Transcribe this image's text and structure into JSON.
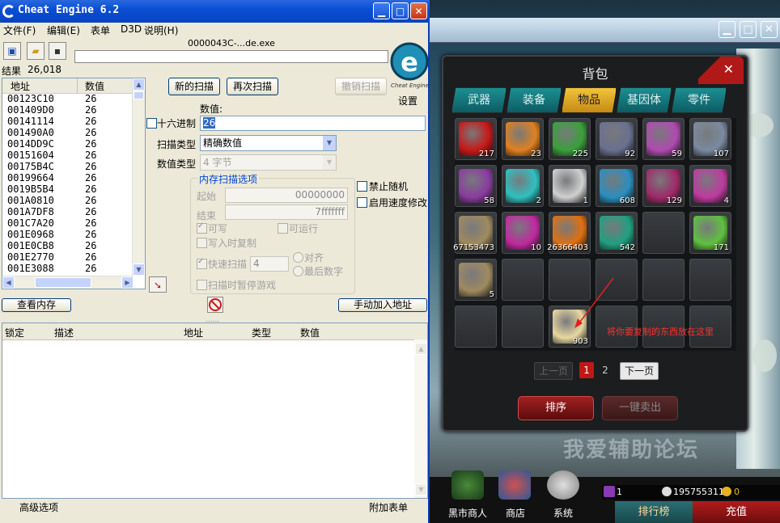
{
  "ce": {
    "title": "Cheat Engine 6.2",
    "menu": [
      "文件(F)",
      "编辑(E)",
      "表单",
      "D3D",
      "说明(H)"
    ],
    "process": "0000043C-...de.exe",
    "results_label": "结果",
    "results_count": "26,018",
    "settings": "设置",
    "logo_text": "Cheat Engine",
    "list_headers": {
      "address": "地址",
      "value": "数值"
    },
    "addresses": [
      {
        "a": "00123C10",
        "v": "26"
      },
      {
        "a": "001409D0",
        "v": "26"
      },
      {
        "a": "00141114",
        "v": "26"
      },
      {
        "a": "001490A0",
        "v": "26"
      },
      {
        "a": "0014DD9C",
        "v": "26"
      },
      {
        "a": "00151604",
        "v": "26"
      },
      {
        "a": "00175B4C",
        "v": "26"
      },
      {
        "a": "00199664",
        "v": "26"
      },
      {
        "a": "0019B5B4",
        "v": "26"
      },
      {
        "a": "001A0810",
        "v": "26"
      },
      {
        "a": "001A7DF8",
        "v": "26"
      },
      {
        "a": "001C7A20",
        "v": "26"
      },
      {
        "a": "001E0968",
        "v": "26"
      },
      {
        "a": "001E0CB8",
        "v": "26"
      },
      {
        "a": "001E2770",
        "v": "26"
      },
      {
        "a": "001E3088",
        "v": "26"
      }
    ],
    "buttons": {
      "new_scan": "新的扫描",
      "next_scan": "再次扫描",
      "undo_scan": "撤销扫描",
      "view_memory": "查看内存",
      "add_manual": "手动加入地址"
    },
    "value_label": "数值:",
    "hex_label": "十六进制",
    "value_input": "26",
    "scan_type_label": "扫描类型",
    "scan_type": "精确数值",
    "value_type_label": "数值类型",
    "value_type": "4 字节",
    "mem_options": {
      "title": "内存扫描选项",
      "start_label": "起始",
      "start": "00000000",
      "stop_label": "结束",
      "stop": "7fffffff",
      "writable": "可写",
      "executable": "可运行",
      "copy_on_write": "写入时复制",
      "fast_scan": "快速扫描",
      "fast_scan_value": "4",
      "align": "对齐",
      "last_digits": "最后数字",
      "pause": "扫描时暂停游戏"
    },
    "disable_random": "禁止随机",
    "speedhack": "启用速度修改",
    "table_headers": [
      "锁定",
      "描述",
      "地址",
      "类型",
      "数值"
    ],
    "advanced": "高级选项",
    "table_extras": "附加表单"
  },
  "game": {
    "panel_title": "背包",
    "tabs": [
      "武器",
      "装备",
      "物品",
      "基因体",
      "零件"
    ],
    "active_tab": 2,
    "items": [
      {
        "row": 0,
        "col": 0,
        "count": "217",
        "color": "#c81818",
        "kind": "red-potion"
      },
      {
        "row": 0,
        "col": 1,
        "count": "23",
        "color": "#e08020",
        "kind": "orange-potion"
      },
      {
        "row": 0,
        "col": 2,
        "count": "225",
        "color": "#3aa03a",
        "kind": "green-box"
      },
      {
        "row": 0,
        "col": 3,
        "count": "92",
        "color": "#6a7090",
        "kind": "eyes-box"
      },
      {
        "row": 0,
        "col": 4,
        "count": "59",
        "color": "#b04ab0",
        "kind": "eyes-box-purple"
      },
      {
        "row": 0,
        "col": 5,
        "count": "107",
        "color": "#7a8aa0",
        "kind": "steel-box"
      },
      {
        "row": 1,
        "col": 0,
        "count": "58",
        "color": "#8a3ca0",
        "kind": "purple-chest"
      },
      {
        "row": 1,
        "col": 1,
        "count": "2",
        "color": "#2fc0c0",
        "kind": "exp-card"
      },
      {
        "row": 1,
        "col": 2,
        "count": "1",
        "color": "#d0d0d0",
        "kind": "phone"
      },
      {
        "row": 1,
        "col": 3,
        "count": "608",
        "color": "#2a8fc0",
        "kind": "card"
      },
      {
        "row": 1,
        "col": 4,
        "count": "129",
        "color": "#a02a6a",
        "kind": "soul-chip"
      },
      {
        "row": 1,
        "col": 5,
        "count": "4",
        "color": "#c03aa0",
        "kind": "pink-crystal"
      },
      {
        "row": 2,
        "col": 0,
        "count": "67153473",
        "color": "#a08a60",
        "kind": "car-card"
      },
      {
        "row": 2,
        "col": 1,
        "count": "10",
        "color": "#c02aa0",
        "kind": "magenta-crystal"
      },
      {
        "row": 2,
        "col": 2,
        "count": "26366403",
        "color": "#e07010",
        "kind": "orange-crystal"
      },
      {
        "row": 2,
        "col": 3,
        "count": "542",
        "color": "#20a080",
        "kind": "teal-crystal"
      },
      {
        "row": 2,
        "col": 5,
        "count": "171",
        "color": "#60c040",
        "kind": "green-vial"
      },
      {
        "row": 3,
        "col": 0,
        "count": "5",
        "color": "#a08a60",
        "kind": "charlot-card"
      },
      {
        "row": 4,
        "col": 2,
        "count": "903",
        "color": "#e8d8a0",
        "kind": "scroll"
      }
    ],
    "hint": "将你要复制的东西放在这里",
    "prev_page": "上一页",
    "pages": [
      "1",
      "2"
    ],
    "next_page": "下一页",
    "sort": "排序",
    "sell_all": "一键卖出",
    "watermark": "我爱辅助论坛",
    "bottom": {
      "black_market": "黑市商人",
      "shop": "商店",
      "system": "系统",
      "rank": "排行榜",
      "recharge": "充值",
      "currency1": "1",
      "gold": "195755311",
      "coin": "0"
    }
  }
}
